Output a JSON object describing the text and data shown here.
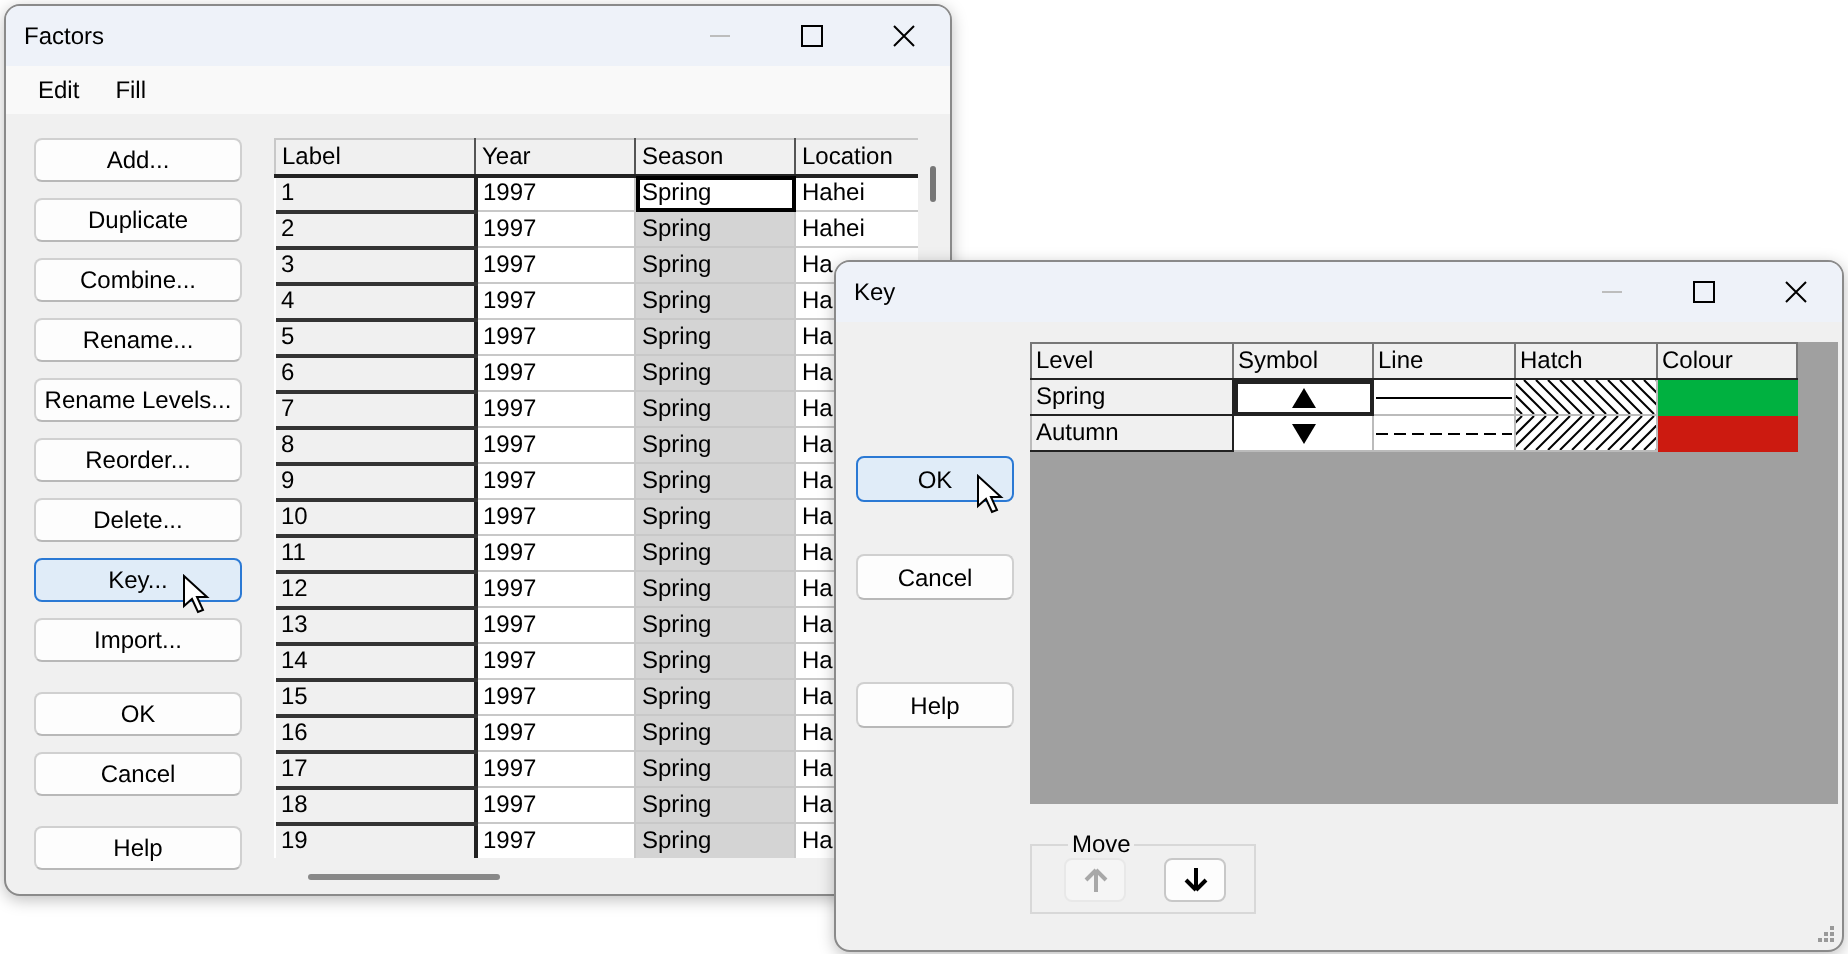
{
  "factors_window": {
    "title": "Factors",
    "menu": [
      "Edit",
      "Fill"
    ],
    "button_groups": [
      {
        "buttons": [
          {
            "label": "Add...",
            "focused": false
          },
          {
            "label": "Duplicate",
            "focused": false
          },
          {
            "label": "Combine...",
            "focused": false
          },
          {
            "label": "Rename...",
            "focused": false
          },
          {
            "label": "Rename Levels...",
            "focused": false
          },
          {
            "label": "Reorder...",
            "focused": false
          },
          {
            "label": "Delete...",
            "focused": false
          },
          {
            "label": "Key...",
            "focused": true
          },
          {
            "label": "Import...",
            "focused": false
          }
        ]
      },
      {
        "buttons": [
          {
            "label": "OK",
            "focused": false
          },
          {
            "label": "Cancel",
            "focused": false
          }
        ]
      },
      {
        "buttons": [
          {
            "label": "Help",
            "focused": false
          }
        ]
      }
    ],
    "table": {
      "columns": [
        "Label",
        "Year",
        "Season",
        "Location"
      ],
      "rows": [
        {
          "cells": [
            "1",
            "1997",
            "Spring",
            "Hahei"
          ],
          "selected": true
        },
        {
          "cells": [
            "2",
            "1997",
            "Spring",
            "Hahei"
          ],
          "selected": false
        },
        {
          "cells": [
            "3",
            "1997",
            "Spring",
            "Ha"
          ],
          "selected": false
        },
        {
          "cells": [
            "4",
            "1997",
            "Spring",
            "Ha"
          ],
          "selected": false
        },
        {
          "cells": [
            "5",
            "1997",
            "Spring",
            "Ha"
          ],
          "selected": false
        },
        {
          "cells": [
            "6",
            "1997",
            "Spring",
            "Ha"
          ],
          "selected": false
        },
        {
          "cells": [
            "7",
            "1997",
            "Spring",
            "Ha"
          ],
          "selected": false
        },
        {
          "cells": [
            "8",
            "1997",
            "Spring",
            "Ha"
          ],
          "selected": false
        },
        {
          "cells": [
            "9",
            "1997",
            "Spring",
            "Ha"
          ],
          "selected": false
        },
        {
          "cells": [
            "10",
            "1997",
            "Spring",
            "Ha"
          ],
          "selected": false
        },
        {
          "cells": [
            "11",
            "1997",
            "Spring",
            "Ha"
          ],
          "selected": false
        },
        {
          "cells": [
            "12",
            "1997",
            "Spring",
            "Ha"
          ],
          "selected": false
        },
        {
          "cells": [
            "13",
            "1997",
            "Spring",
            "Ha"
          ],
          "selected": false
        },
        {
          "cells": [
            "14",
            "1997",
            "Spring",
            "Ha"
          ],
          "selected": false
        },
        {
          "cells": [
            "15",
            "1997",
            "Spring",
            "Ha"
          ],
          "selected": false
        },
        {
          "cells": [
            "16",
            "1997",
            "Spring",
            "Ha"
          ],
          "selected": false
        },
        {
          "cells": [
            "17",
            "1997",
            "Spring",
            "Ha"
          ],
          "selected": false
        },
        {
          "cells": [
            "18",
            "1997",
            "Spring",
            "Ha"
          ],
          "selected": false
        },
        {
          "cells": [
            "19",
            "1997",
            "Spring",
            "Ha"
          ],
          "selected": false
        }
      ]
    }
  },
  "key_window": {
    "title": "Key",
    "buttons": [
      {
        "label": "OK",
        "focused": true
      },
      {
        "label": "Cancel",
        "focused": false
      },
      {
        "label": "Help",
        "focused": false
      }
    ],
    "table": {
      "columns": [
        "Level",
        "Symbol",
        "Line",
        "Hatch",
        "Colour"
      ],
      "rows": [
        {
          "level": "Spring",
          "symbol": {
            "kind": "triangle-up"
          },
          "line": {
            "kind": "solid"
          },
          "hatch": {
            "kind": "backward-diagonal"
          },
          "color": "#00b140",
          "selected": true
        },
        {
          "level": "Autumn",
          "symbol": {
            "kind": "triangle-down"
          },
          "line": {
            "kind": "dashed"
          },
          "hatch": {
            "kind": "forward-diagonal"
          },
          "color": "#cc1a10",
          "selected": false
        }
      ]
    },
    "move": {
      "label": "Move",
      "buttons": [
        {
          "kind": "up",
          "disabled": true
        },
        {
          "kind": "down",
          "disabled": false
        }
      ]
    }
  }
}
